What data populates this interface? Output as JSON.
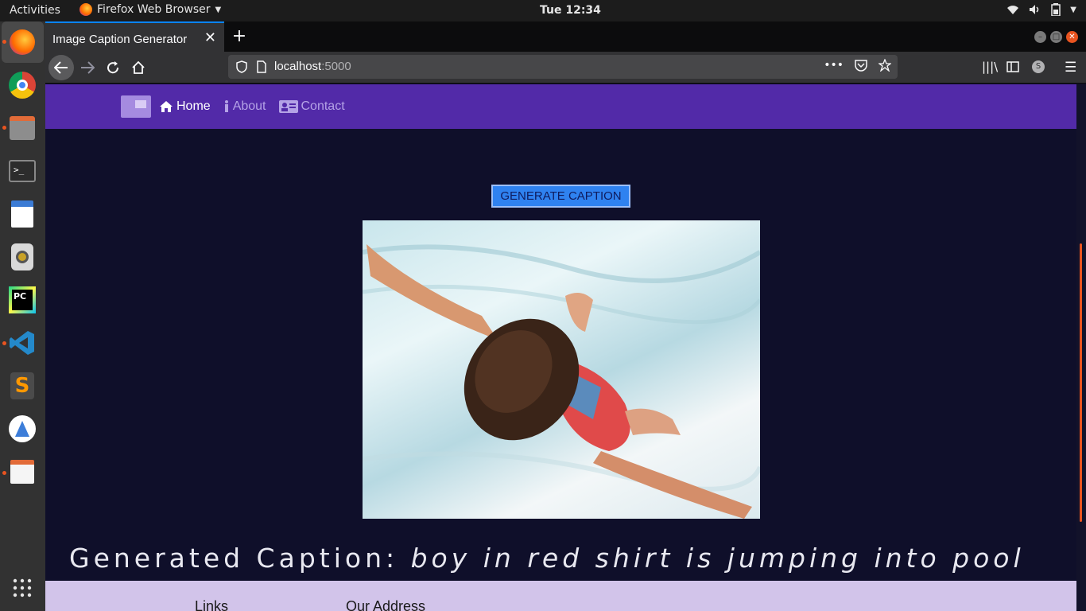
{
  "system": {
    "activities": "Activities",
    "app_name": "Firefox Web Browser",
    "clock": "Tue 12:34"
  },
  "browser": {
    "tab_title": "Image Caption Generator",
    "url_host": "localhost",
    "url_port": ":5000",
    "accent": "#0a84ff"
  },
  "site": {
    "nav": [
      {
        "label": "Home",
        "icon": "home-icon",
        "active": true
      },
      {
        "label": "About",
        "icon": "info-icon",
        "active": false
      },
      {
        "label": "Contact",
        "icon": "contact-card-icon",
        "active": false
      }
    ],
    "nav_color": "#522aa8",
    "generate_button": "GENERATE CAPTION",
    "caption_label": "Generated Caption:",
    "caption_text": "boy in red shirt is jumping into pool",
    "footer": {
      "links_heading": "Links",
      "address_heading": "Our Address"
    }
  },
  "dock": [
    "firefox-icon",
    "chrome-icon",
    "files-icon",
    "terminal-icon",
    "image-viewer-icon",
    "speaker-icon",
    "pycharm-icon",
    "vscode-icon",
    "sublime-icon",
    "android-studio-icon",
    "text-editor-icon",
    "show-apps-icon"
  ]
}
